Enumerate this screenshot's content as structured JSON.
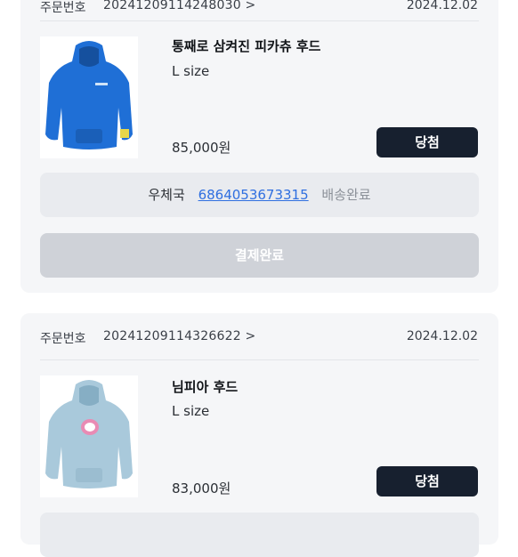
{
  "orders": [
    {
      "label": "주문번호",
      "number": "20241209114248030 >",
      "date": "2024.12.02",
      "product": {
        "name": "통째로 삼켜진 피카츄 후드",
        "size": "L size",
        "price": "85,000원",
        "image_icon": "blue-hoodie-image"
      },
      "badge": "당첨",
      "shipping": {
        "carrier": "우체국",
        "tracking": "6864053673315",
        "status": "배송완료"
      },
      "payment_button": "결제완료"
    },
    {
      "label": "주문번호",
      "number": "20241209114326622 >",
      "date": "2024.12.02",
      "product": {
        "name": "님피아 후드",
        "size": "L size",
        "price": "83,000원",
        "image_icon": "light-blue-hoodie-image"
      },
      "badge": "당첨"
    }
  ],
  "colors": {
    "card_bg": "#f5f6f8",
    "badge_bg": "#17202f",
    "tracking_link": "#2f6fe0",
    "pay_button_disabled": "#cfd2d8",
    "hoodie_blue": "#1f6fd6",
    "hoodie_light_blue": "#a9c9db"
  }
}
